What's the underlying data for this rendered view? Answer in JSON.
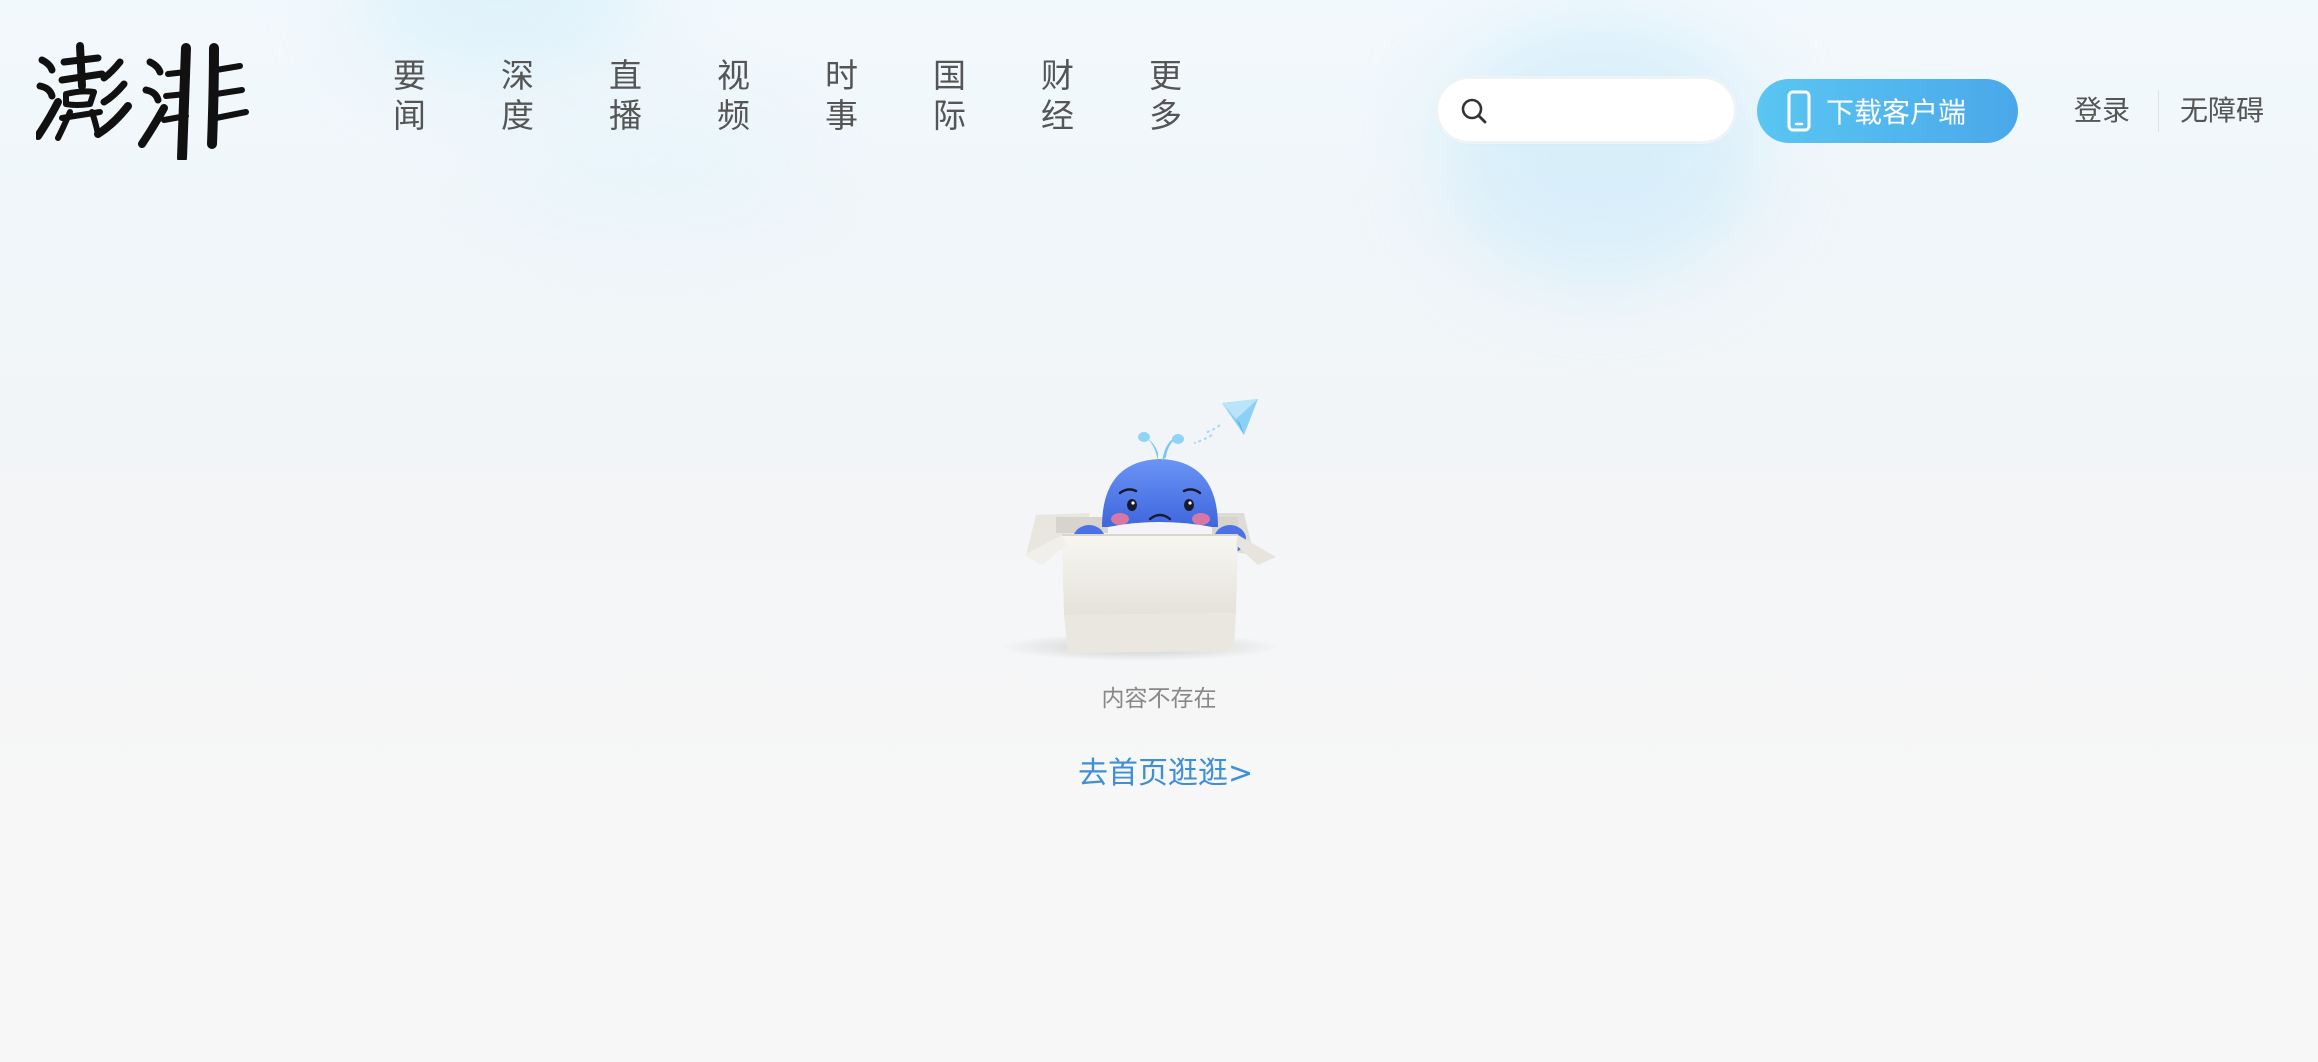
{
  "header": {
    "logo_text": "澎湃",
    "nav": [
      {
        "line1": "要",
        "line2": "闻"
      },
      {
        "line1": "深",
        "line2": "度"
      },
      {
        "line1": "直",
        "line2": "播"
      },
      {
        "line1": "视",
        "line2": "频"
      },
      {
        "line1": "时",
        "line2": "事"
      },
      {
        "line1": "国",
        "line2": "际"
      },
      {
        "line1": "财",
        "line2": "经"
      },
      {
        "line1": "更",
        "line2": "多"
      }
    ],
    "search": {
      "value": "",
      "placeholder": ""
    },
    "download_label": "下载客户端",
    "login_label": "登录",
    "accessibility_label": "无障碍"
  },
  "empty_state": {
    "message": "内容不存在",
    "home_link": "去首页逛逛>"
  },
  "icons": {
    "search": "search-icon",
    "download": "phone-icon",
    "illustration": "sad-whale-in-box-illustration",
    "plane": "paper-plane-icon"
  },
  "colors": {
    "accent_blue": "#4aa8ea",
    "link_blue": "#3f8fd6",
    "whale_blue": "#4d78e8",
    "text_gray": "#555555",
    "muted_gray": "#888888"
  }
}
